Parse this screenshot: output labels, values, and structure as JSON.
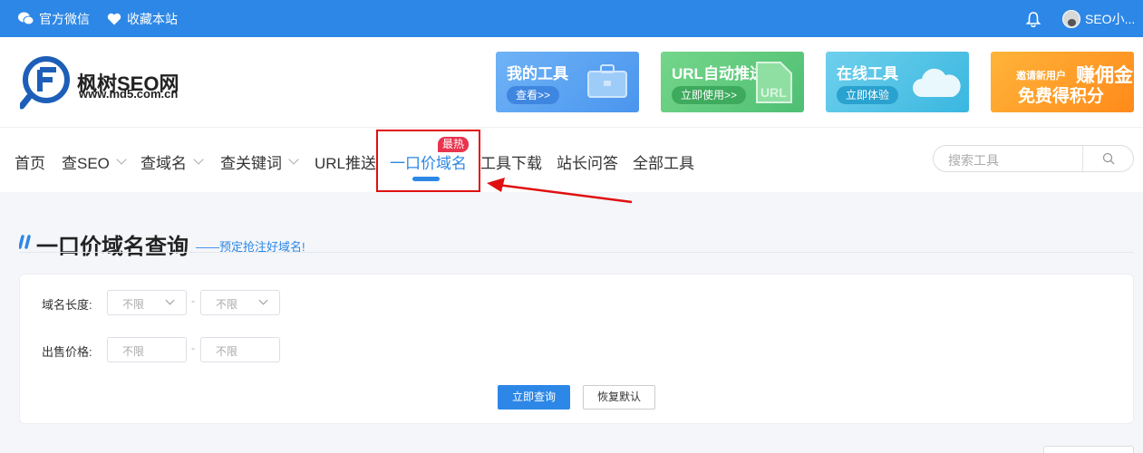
{
  "topbar": {
    "wechat_label": "官方微信",
    "favorite_label": "收藏本站",
    "user_name": "SEO小..."
  },
  "logo": {
    "name": "枫树SEO网",
    "domain": "www.md5.com.cn"
  },
  "promo_cards": [
    {
      "title": "我的工具",
      "button": "查看>>"
    },
    {
      "title": "URL自动推送",
      "button": "立即使用>>"
    },
    {
      "title": "在线工具",
      "button": "立即体验"
    },
    {
      "title": "赚佣金",
      "subtitle": "免费得积分",
      "tag": "邀请新用户"
    }
  ],
  "nav": {
    "items": [
      "首页",
      "查SEO",
      "查域名",
      "查关键词",
      "URL推送",
      "一口价域名",
      "工具下载",
      "站长问答",
      "全部工具"
    ],
    "hot_badge": "最热",
    "search_placeholder": "搜索工具"
  },
  "section": {
    "title": "一口价域名查询",
    "subtitle": "——预定抢注好域名!"
  },
  "form": {
    "length_label": "域名长度:",
    "price_label": "出售价格:",
    "length_min": "不限",
    "length_max": "不限",
    "price_min": "不限",
    "price_max": "不限",
    "separator": "-",
    "query_button": "立即查询",
    "reset_button": "恢复默认"
  },
  "colors": {
    "primary": "#2d87e6",
    "hot": "#e8344e",
    "highlight": "#e01010"
  }
}
